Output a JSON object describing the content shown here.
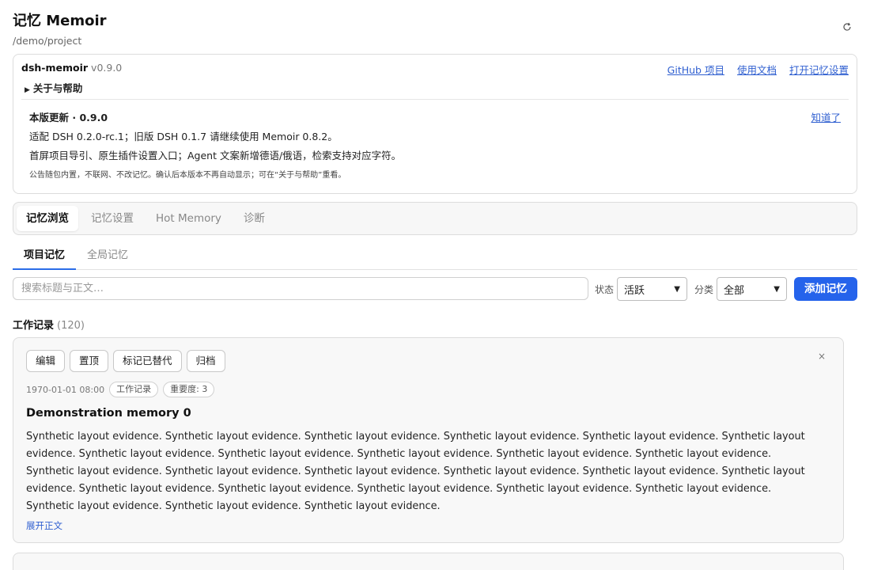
{
  "header": {
    "title": "记忆 Memoir",
    "path": "/demo/project",
    "refresh_icon": "refresh-icon"
  },
  "plugin": {
    "name": "dsh-memoir",
    "version": "v0.9.0",
    "links": {
      "github": "GitHub 项目",
      "docs": "使用文档",
      "settings": "打开记忆设置"
    },
    "about_label": "关于与帮助"
  },
  "notice": {
    "title": "本版更新 · 0.9.0",
    "ack": "知道了",
    "line1": "适配 DSH 0.2.0-rc.1；旧版 DSH 0.1.7 请继续使用 Memoir 0.8.2。",
    "line2": "首屏项目导引、原生插件设置入口；Agent 文案新增德语/俄语，检索支持对应字符。",
    "fine": "公告随包内置，不联网、不改记忆。确认后本版本不再自动显示；可在“关于与帮助”重看。"
  },
  "tabs": [
    {
      "label": "记忆浏览",
      "active": true
    },
    {
      "label": "记忆设置",
      "active": false
    },
    {
      "label": "Hot Memory",
      "active": false
    },
    {
      "label": "诊断",
      "active": false
    }
  ],
  "subtabs": [
    {
      "label": "项目记忆",
      "active": true
    },
    {
      "label": "全局记忆",
      "active": false
    }
  ],
  "filters": {
    "search_placeholder": "搜索标题与正文…",
    "status_label": "状态",
    "status_value": "活跃",
    "category_label": "分类",
    "category_value": "全部",
    "add_button": "添加记忆"
  },
  "section": {
    "title": "工作记录",
    "count": "(120)"
  },
  "memory": {
    "actions": {
      "edit": "编辑",
      "pin": "置顶",
      "mark_replaced": "标记已替代",
      "archive": "归档"
    },
    "close": "×",
    "date": "1970-01-01 08:00",
    "category_chip": "工作记录",
    "importance_chip": "重要度: 3",
    "title": "Demonstration memory 0",
    "body": "Synthetic layout evidence. Synthetic layout evidence. Synthetic layout evidence. Synthetic layout evidence. Synthetic layout evidence. Synthetic layout evidence. Synthetic layout evidence. Synthetic layout evidence. Synthetic layout evidence. Synthetic layout evidence. Synthetic layout evidence. Synthetic layout evidence. Synthetic layout evidence. Synthetic layout evidence. Synthetic layout evidence. Synthetic layout evidence. Synthetic layout evidence. Synthetic layout evidence. Synthetic layout evidence. Synthetic layout evidence. Synthetic layout evidence. Synthetic layout evidence. Synthetic layout evidence. Synthetic layout evidence. Synthetic layout evidence.",
    "expand": "展开正文"
  },
  "colors": {
    "accent": "#2563eb",
    "link": "#2f5fd0"
  }
}
